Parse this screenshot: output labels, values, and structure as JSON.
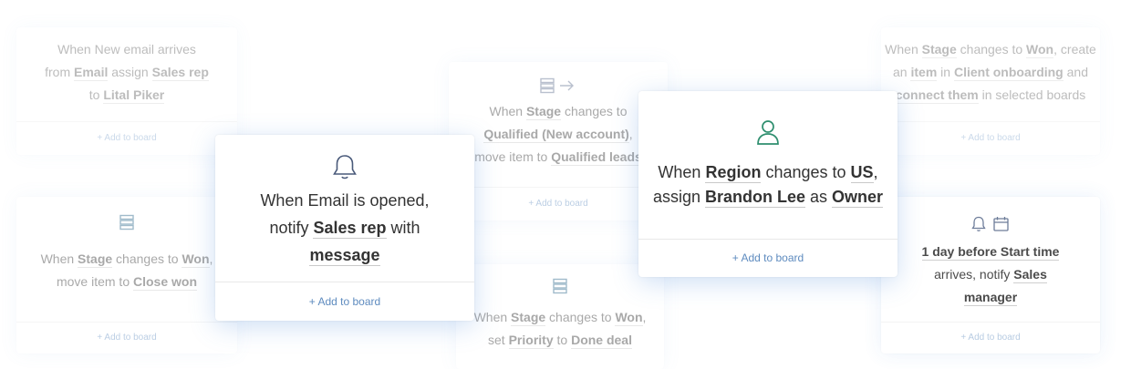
{
  "cards": [
    {
      "id": "c1",
      "parts": [
        [
          "When New email arrives",
          false
        ],
        [
          "from ",
          false
        ],
        [
          "Email",
          true
        ],
        [
          " assign ",
          false
        ],
        [
          "Sales rep",
          true
        ],
        [
          "to ",
          false
        ],
        [
          "Lital Piker",
          true
        ]
      ],
      "footer": "+ Add to board"
    },
    {
      "id": "c2",
      "parts": [
        [
          "When ",
          false
        ],
        [
          "Stage",
          true
        ],
        [
          " changes to ",
          false
        ],
        [
          "Won",
          true
        ],
        [
          ",",
          false
        ],
        [
          "move item to ",
          false
        ],
        [
          "Close won",
          true
        ]
      ],
      "footer": "+ Add to board",
      "icon": "board-icon"
    },
    {
      "id": "c3",
      "parts": [
        [
          "When Email is opened,",
          false
        ],
        [
          "notify ",
          false
        ],
        [
          "Sales rep",
          true
        ],
        [
          " with",
          false
        ],
        [
          "message",
          true
        ]
      ],
      "footer": "+ Add to board",
      "icon": "bell-icon"
    },
    {
      "id": "c4",
      "parts": [
        [
          "When ",
          false
        ],
        [
          "Stage",
          true
        ],
        [
          " changes to",
          false
        ],
        [
          "Qualified (New account)",
          true
        ],
        [
          ",",
          false
        ],
        [
          "move item to ",
          false
        ],
        [
          "Qualified leads",
          true
        ]
      ],
      "footer": "+ Add to board",
      "icon": "board-arrow-icon"
    },
    {
      "id": "c5",
      "parts": [
        [
          "When ",
          false
        ],
        [
          "Stage",
          true
        ],
        [
          " changes to ",
          false
        ],
        [
          "Won",
          true
        ],
        [
          ",",
          false
        ],
        [
          "set ",
          false
        ],
        [
          "Priority",
          true
        ],
        [
          " to ",
          false
        ],
        [
          "Done deal",
          true
        ]
      ],
      "icon": "board-icon"
    },
    {
      "id": "c6",
      "parts": [
        [
          "When ",
          false
        ],
        [
          "Region",
          true
        ],
        [
          " changes to ",
          false
        ],
        [
          "US",
          true
        ],
        [
          ",",
          false
        ],
        [
          "assign ",
          false
        ],
        [
          "Brandon Lee",
          true
        ],
        [
          " as ",
          false
        ],
        [
          "Owner",
          true
        ]
      ],
      "footer": "+ Add to board",
      "icon": "person-icon"
    },
    {
      "id": "c7",
      "parts": [
        [
          "When ",
          false
        ],
        [
          "Stage",
          true
        ],
        [
          " changes to ",
          false
        ],
        [
          "Won",
          true
        ],
        [
          ", create",
          false
        ],
        [
          "an ",
          false
        ],
        [
          "item",
          true
        ],
        [
          " in ",
          false
        ],
        [
          "Client onboarding",
          true
        ],
        [
          " and",
          false
        ],
        [
          "connect them",
          true
        ],
        [
          " in selected boards",
          false
        ]
      ],
      "footer": "+ Add to board"
    },
    {
      "id": "c8",
      "parts": [
        [
          "1 day before Start time",
          true
        ],
        [
          "arrives, notify ",
          false
        ],
        [
          "Sales",
          true
        ],
        [
          "manager",
          true
        ]
      ],
      "footer": "+ Add to board",
      "icon": "bell-calendar-icon"
    }
  ],
  "colors": {
    "accent": "#2f8f6f",
    "link": "#5e8bbf",
    "icon": "#5a6b8c"
  }
}
